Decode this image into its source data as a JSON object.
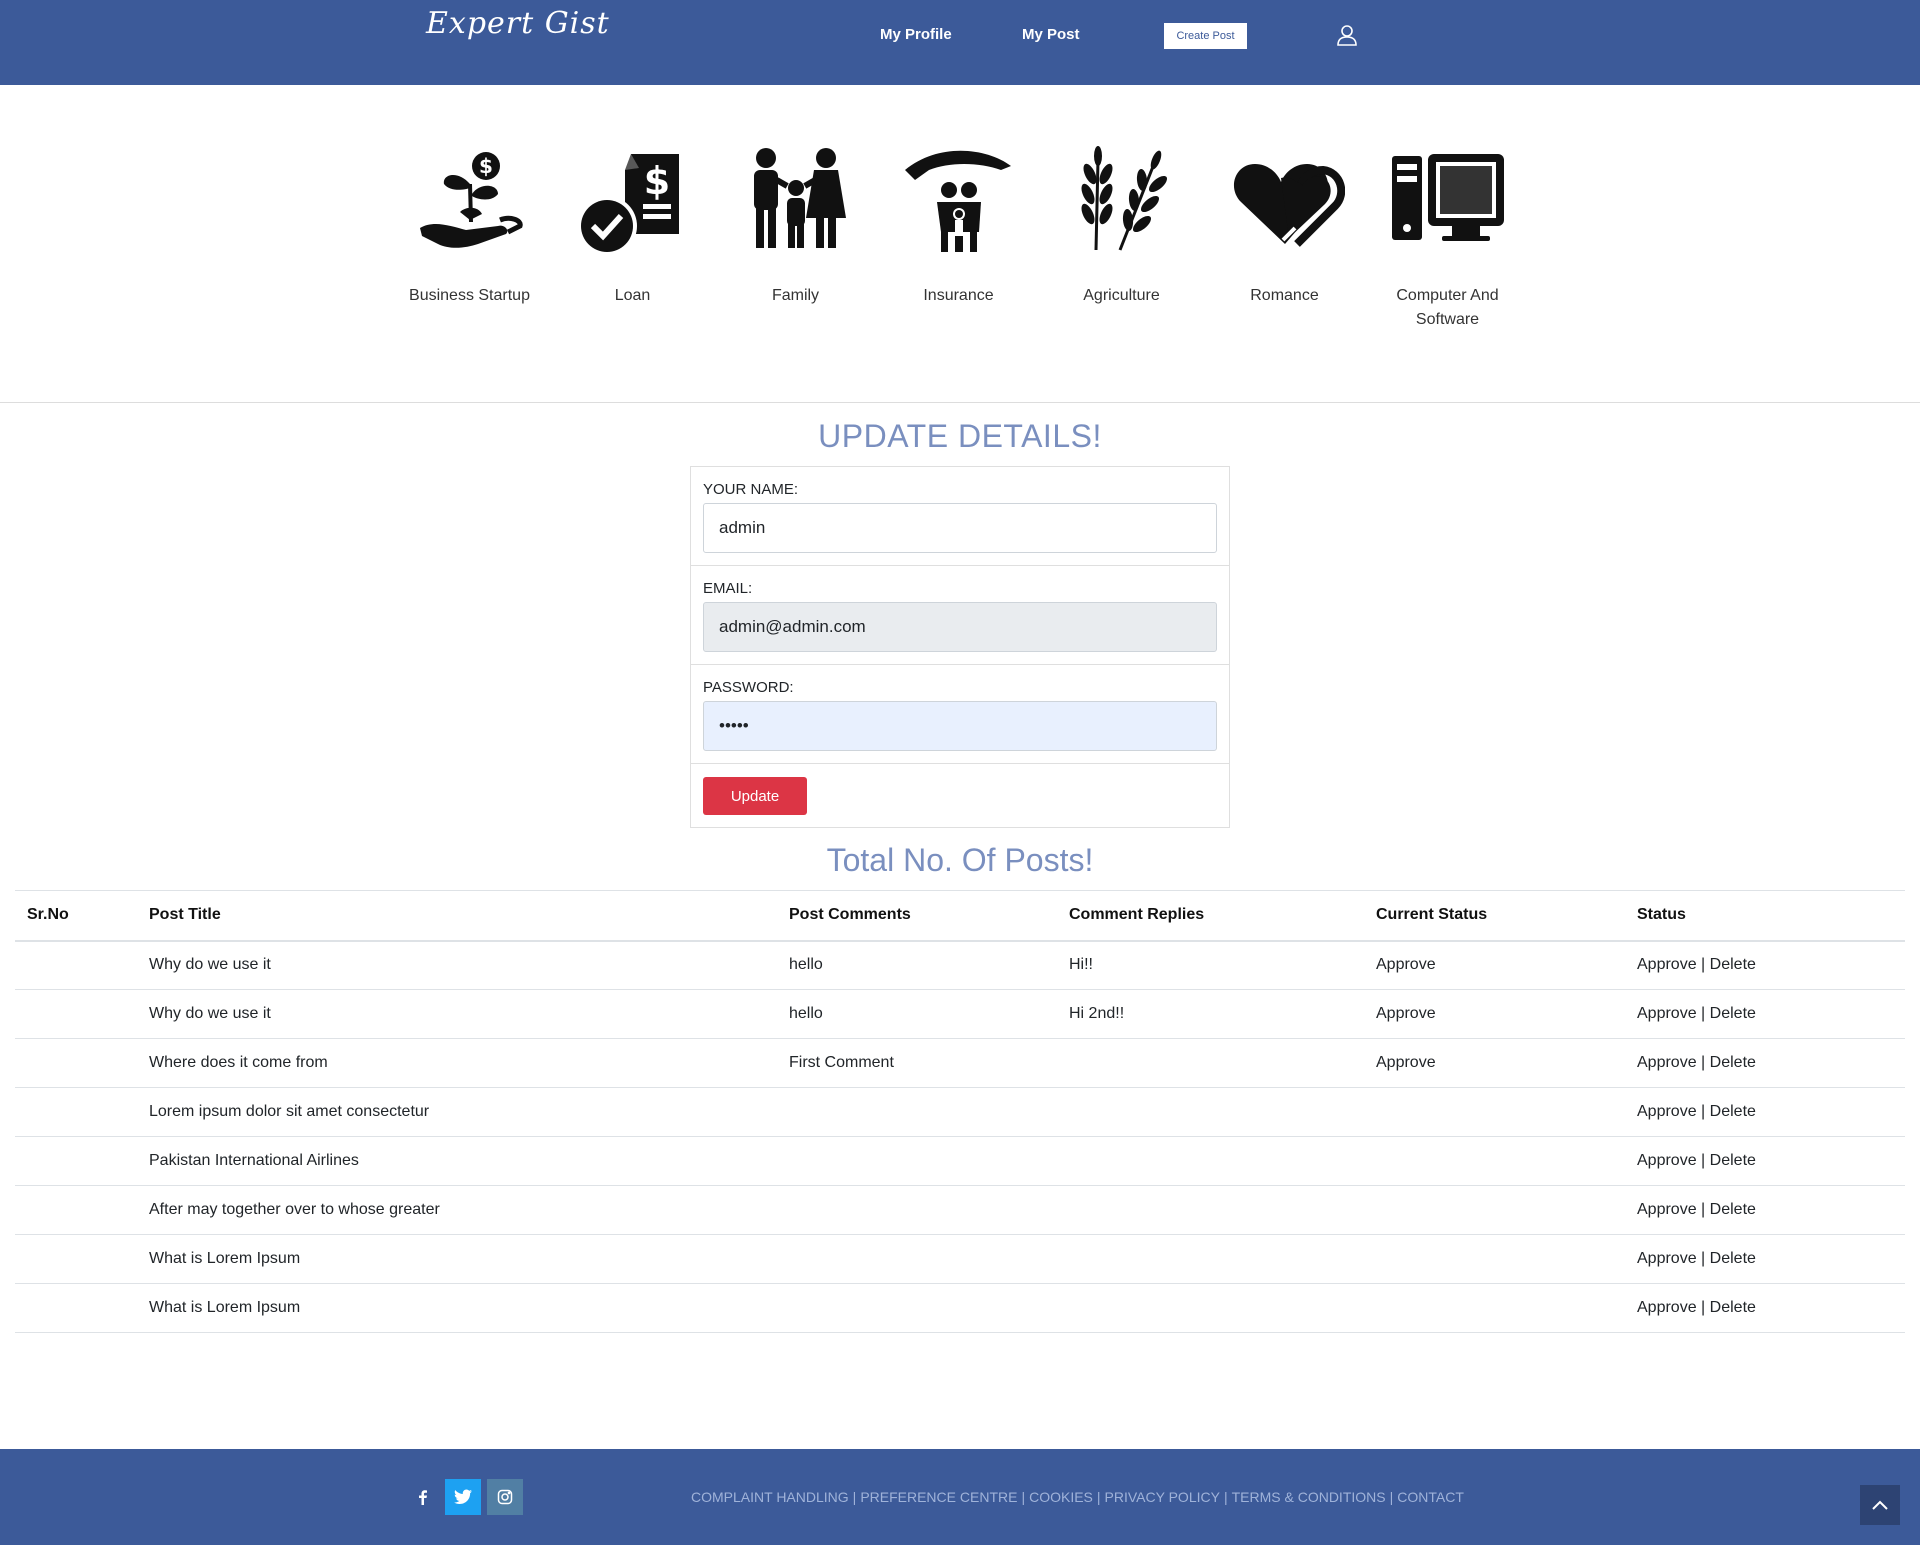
{
  "header": {
    "logo": "Expert Gist",
    "nav": {
      "profile": "My Profile",
      "post": "My Post"
    },
    "create_post": "Create Post",
    "user_icon": "user-icon"
  },
  "categories": [
    {
      "label": "Business Startup",
      "icon": "plant-money-hand-icon"
    },
    {
      "label": "Loan",
      "icon": "loan-document-icon"
    },
    {
      "label": "Family",
      "icon": "family-icon"
    },
    {
      "label": "Insurance",
      "icon": "insurance-umbrella-icon"
    },
    {
      "label": "Agriculture",
      "icon": "wheat-icon"
    },
    {
      "label": "Romance",
      "icon": "hearts-icon"
    },
    {
      "label": "Computer And Software",
      "icon": "computer-icon"
    }
  ],
  "form": {
    "title": "UPDATE DETAILS!",
    "name_label": "YOUR NAME:",
    "name_value": "admin",
    "email_label": "EMAIL:",
    "email_value": "admin@admin.com",
    "password_label": "PASSWORD:",
    "password_value": "•••••",
    "submit": "Update"
  },
  "posts": {
    "title": "Total No. Of Posts!",
    "columns": [
      "Sr.No",
      "Post Title",
      "Post Comments",
      "Comment Replies",
      "Current Status",
      "Status"
    ],
    "rows": [
      {
        "sr": "",
        "title": "Why do we use it",
        "comment": "hello",
        "reply": "Hi!!",
        "current": "Approve"
      },
      {
        "sr": "",
        "title": "Why do we use it",
        "comment": "hello",
        "reply": "Hi 2nd!!",
        "current": "Approve"
      },
      {
        "sr": "",
        "title": "Where does it come from",
        "comment": "First Comment",
        "reply": "",
        "current": "Approve"
      },
      {
        "sr": "",
        "title": "Lorem ipsum dolor sit amet consectetur",
        "comment": "",
        "reply": "",
        "current": ""
      },
      {
        "sr": "",
        "title": "Pakistan International Airlines",
        "comment": "",
        "reply": "",
        "current": ""
      },
      {
        "sr": "",
        "title": "After may together over to whose greater",
        "comment": "",
        "reply": "",
        "current": ""
      },
      {
        "sr": "",
        "title": "What is Lorem Ipsum",
        "comment": "",
        "reply": "",
        "current": ""
      },
      {
        "sr": "",
        "title": "What is Lorem Ipsum",
        "comment": "",
        "reply": "",
        "current": ""
      }
    ],
    "action_approve": "Approve",
    "action_sep": "|",
    "action_delete": "Delete"
  },
  "footer": {
    "social": [
      "facebook-icon",
      "twitter-icon",
      "instagram-icon"
    ],
    "links": [
      "COMPLAINT HANDLING",
      "PREFERENCE CENTRE",
      "COOKIES",
      "PRIVACY POLICY",
      "TERMS & CONDITIONS",
      "CONTACT"
    ],
    "separator": "|"
  },
  "colors": {
    "brand": "#3c5a99",
    "accent_title": "#7a8fbf",
    "danger": "#dc3545",
    "twitter": "#1da1f2",
    "instagram": "#517fa4"
  }
}
